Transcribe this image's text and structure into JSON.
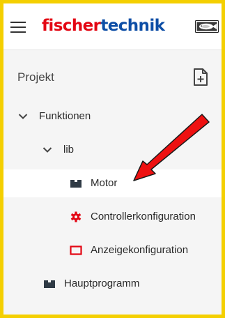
{
  "header": {
    "logo_part1": "fischer",
    "logo_part2": "technik",
    "menu_icon": "hamburger-menu-icon",
    "logo_mark_icon": "fish-logo-icon"
  },
  "panel": {
    "title": "Projekt",
    "add_icon": "add-file-icon"
  },
  "tree": {
    "items": [
      {
        "label": "Funktionen",
        "icon": "chevron-down-icon",
        "level": 0,
        "expanded": true
      },
      {
        "label": "lib",
        "icon": "chevron-down-icon",
        "level": 1,
        "expanded": true
      },
      {
        "label": "Motor",
        "icon": "puzzle-block-icon",
        "level": 2,
        "selected": true
      },
      {
        "label": "Controllerkonfiguration",
        "icon": "gear-icon",
        "level": 2
      },
      {
        "label": "Anzeigekonfiguration",
        "icon": "display-icon",
        "level": 2
      },
      {
        "label": "Hauptprogramm",
        "icon": "puzzle-block-icon",
        "level": 0
      }
    ]
  },
  "annotation": {
    "arrow_icon": "red-arrow-icon"
  },
  "colors": {
    "frame_border": "#f4cf00",
    "brand_red": "#e30613",
    "brand_blue": "#0d4ea6",
    "icon_dark": "#2f3a45"
  }
}
